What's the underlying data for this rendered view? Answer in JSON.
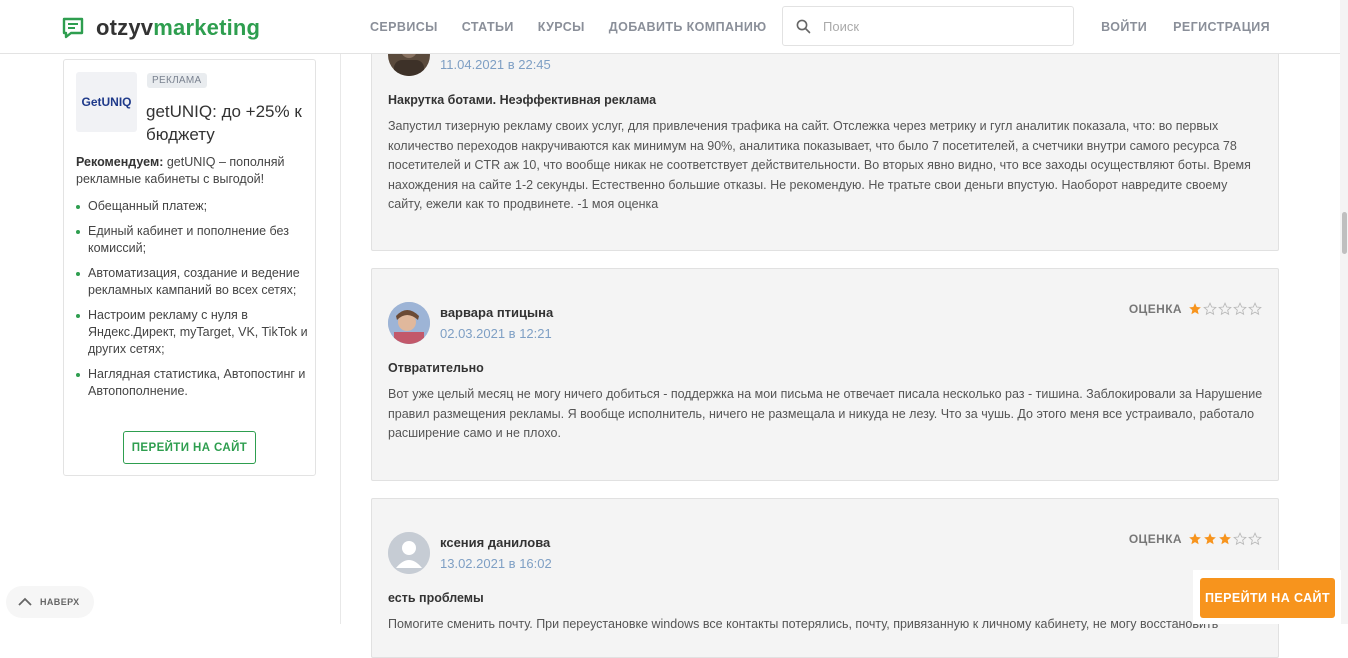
{
  "header": {
    "logo_part1": "otzyv",
    "logo_part2": "marketing",
    "nav": [
      "СЕРВИСЫ",
      "СТАТЬИ",
      "КУРСЫ",
      "ДОБАВИТЬ КОМПАНИЮ"
    ],
    "search_placeholder": "Поиск",
    "login": "ВОЙТИ",
    "register": "РЕГИСТРАЦИЯ"
  },
  "ad": {
    "logo_text": "GetUNIQ",
    "badge": "РЕКЛАМА",
    "title": "getUNIQ: до +25% к бюджету",
    "desc_bold": "Рекомендуем:",
    "desc_rest": " getUNIQ – пополняй рекламные кабинеты с выгодой!",
    "items": [
      "Обещанный платеж;",
      "Единый кабинет и пополнение без комиссий;",
      "Автоматизация, создание и ведение рекламных кампаний во всех сетях;",
      "Настроим рекламу с нуля в Яндекс.Директ, myTarget, VK, TikTok и других сетях;",
      "Наглядная статистика, Автопостинг и Автопополнение."
    ],
    "button": "ПЕРЕЙТИ НА САЙТ"
  },
  "reviews": [
    {
      "name": "",
      "date": "11.04.2021 в 22:45",
      "title": "Накрутка ботами. Неэффективная реклама",
      "text": "Запустил тизерную рекламу своих услуг, для привлечения трафика на сайт. Отслежка через метрику и гугл аналитик показала, что: во первых количество переходов накручиваются как минимум на 90%, аналитика показывает, что было 7 посетителей, а счетчики внутри самого ресурса 78 посетителей и CTR аж 10, что вообще никак не соответствует действительности. Во вторых явно видно, что все заходы осуществляют боты. Время нахождения на сайте 1-2 секунды. Естественно большие отказы. Не рекомендую. Не тратьте свои деньги впустую. Наоборот навредите своему сайту, ежели как то продвинете. -1 моя оценка"
    },
    {
      "name": "варвара птицына",
      "date": "02.03.2021 в 12:21",
      "rating_label": "ОЦЕНКА",
      "rating": 1,
      "title": "Отвратительно",
      "text": "Вот уже целый месяц не могу ничего добиться - поддержка на мои письма не отвечает писала несколько раз - тишина. Заблокировали за Нарушение правил размещения рекламы. Я вообще исполнитель, ничего не размещала и никуда не лезу. Что за чушь. До этого меня все устраивало, работало расширение само и не плохо."
    },
    {
      "name": "ксения данилова",
      "date": "13.02.2021 в 16:02",
      "rating_label": "ОЦЕНКА",
      "rating": 3,
      "title": "есть проблемы",
      "text": "Помогите сменить почту. При переустановке windows все контакты потерялись, почту, привязанную к личному кабинету, не могу восстановить"
    }
  ],
  "colors": {
    "brand_green": "#2e9e4f",
    "star": "#f7941d",
    "cta": "#f7941d",
    "date": "#7e9fc4"
  },
  "floating": {
    "to_top": "НАВЕРХ",
    "cta": "ПЕРЕЙТИ НА САЙТ"
  }
}
